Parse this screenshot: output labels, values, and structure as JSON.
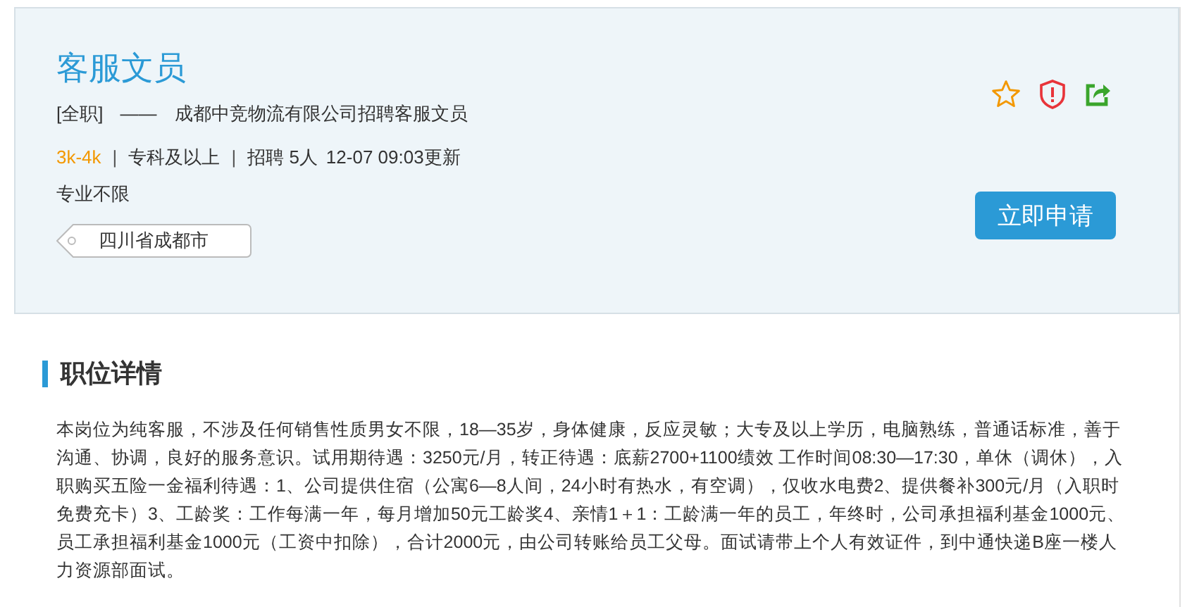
{
  "job": {
    "title": "客服文员",
    "job_type": "[全职]",
    "dash": "——",
    "company_line": "成都中竞物流有限公司招聘客服文员",
    "meta": [
      {
        "kind": "salary",
        "text": "3k-4k"
      },
      {
        "kind": "separator",
        "text": "|"
      },
      {
        "kind": "text",
        "text": "专科及以上"
      },
      {
        "kind": "separator",
        "text": "|"
      },
      {
        "kind": "text",
        "text": "招聘 5人"
      },
      {
        "kind": "text",
        "text": "12-07 09:03更新"
      }
    ],
    "major": "专业不限",
    "location": "四川省成都市",
    "apply_button": "立即申请"
  },
  "details": {
    "section_title": "职位详情",
    "description": "本岗位为纯客服，不涉及任何销售性质男女不限，18—35岁，身体健康，反应灵敏；大专及以上学历，电脑熟练，普通话标准，善于沟通、协调，良好的服务意识。试用期待遇：3250元/月，转正待遇：底薪2700+1100绩效 工作时间08:30—17:30，单休（调休），入职购买五险一金福利待遇：1、公司提供住宿（公寓6—8人间，24小时有热水，有空调），仅收水电费2、提供餐补300元/月（入职时免费充卡）3、工龄奖：工作每满一年，每月增加50元工龄奖4、亲情1＋1：工龄满一年的员工，年终时，公司承担福利基金1000元、员工承担福利基金1000元（工资中扣除），合计2000元，由公司转账给员工父母。面试请带上个人有效证件，到中通快递B座一楼人力资源部面试。"
  }
}
